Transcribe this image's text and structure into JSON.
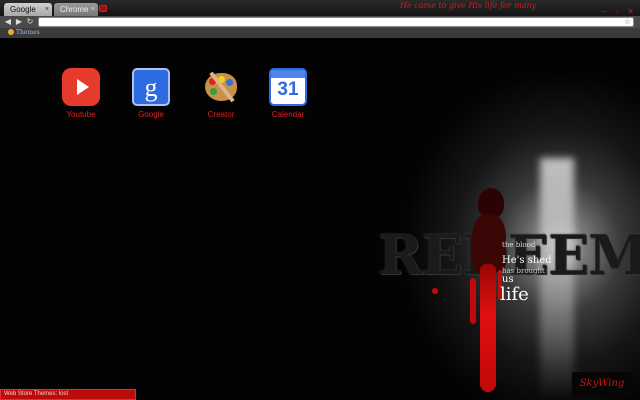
{
  "tabs": [
    {
      "label": "Google",
      "close": "×"
    },
    {
      "label": "Chrome",
      "close": "×"
    }
  ],
  "tagline": "He came to give His life for many",
  "window_controls": {
    "minimize": "–",
    "restore": "▫",
    "close": "✕"
  },
  "toolbar": {
    "back": "◀",
    "forward": "▶",
    "reload": "↻",
    "star": "☆"
  },
  "bookmarks": [
    {
      "label": "Themes",
      "icon": "palette-icon"
    }
  ],
  "apps": [
    {
      "label": "Youtube",
      "icon": "youtube-icon"
    },
    {
      "label": "Google",
      "icon": "google-icon",
      "glyph": "g"
    },
    {
      "label": "Creator",
      "icon": "paint-palette-icon"
    },
    {
      "label": "Calendar",
      "icon": "calendar-icon",
      "glyph": "31"
    }
  ],
  "artwork": {
    "title": "REDEEM",
    "lines": [
      "the blood",
      "He's shed",
      "has brought",
      "us",
      "life"
    ],
    "signature": "SkyWing"
  },
  "status": "Web Store Themes: lost",
  "colors": {
    "accent": "#d81818",
    "blood": "#c30a0a",
    "status_bg": "#bb0b0b"
  }
}
